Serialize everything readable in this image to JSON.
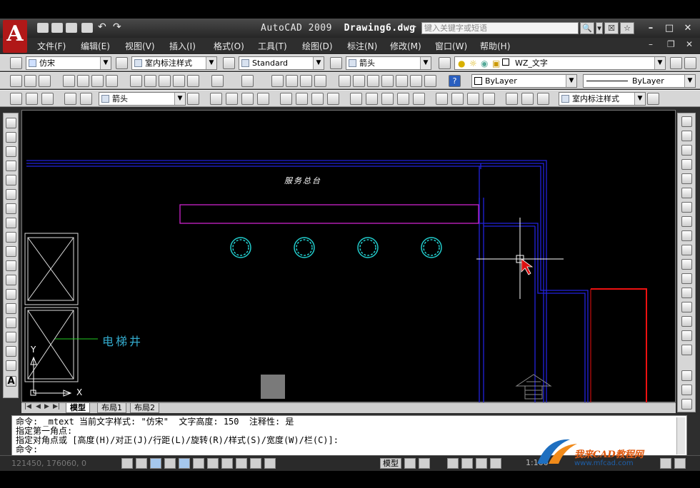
{
  "app": {
    "title_app": "AutoCAD 2009",
    "title_file": "Drawing6.dwg",
    "search_placeholder": "键入关键字或短语",
    "logo_letter": "A"
  },
  "menu": [
    "文件(F)",
    "编辑(E)",
    "视图(V)",
    "插入(I)",
    "格式(O)",
    "工具(T)",
    "绘图(D)",
    "标注(N)",
    "修改(M)",
    "窗口(W)",
    "帮助(H)"
  ],
  "toolbar1": {
    "text_style": "仿宋",
    "dim_style": "室内标注样式",
    "table_style": "Standard",
    "multileader_style": "箭头",
    "layer": "WZ_文字"
  },
  "toolbar2": {
    "color": "ByLayer",
    "linetype": "ByLayer"
  },
  "toolbar3": {
    "leader_style": "箭头",
    "dim_style": "室内标注样式"
  },
  "drawing": {
    "label_service": "服务总台",
    "label_elevator": "电梯井",
    "ucs_x": "X",
    "ucs_y": "Y",
    "colors": {
      "wall": "#1a1acc",
      "counter": "#cc22cc",
      "circles": "#22cccc",
      "red_wall": "#ee1111",
      "white": "#ffffff"
    }
  },
  "tabs": [
    "模型",
    "布局1",
    "布局2"
  ],
  "command": {
    "lines": [
      "命令: _mtext 当前文字样式: \"仿宋\"  文字高度: 150  注释性: 是",
      "指定第一角点:",
      "指定对角点或 [高度(H)/对正(J)/行距(L)/旋转(R)/样式(S)/宽度(W)/栏(C)]:",
      "命令:"
    ]
  },
  "status": {
    "coords": "121450, 176060, 0",
    "model_label": "模型",
    "scale": "1:100"
  },
  "watermark": {
    "brand": "我来CAD教程网",
    "url": "www.mfcad.com"
  }
}
